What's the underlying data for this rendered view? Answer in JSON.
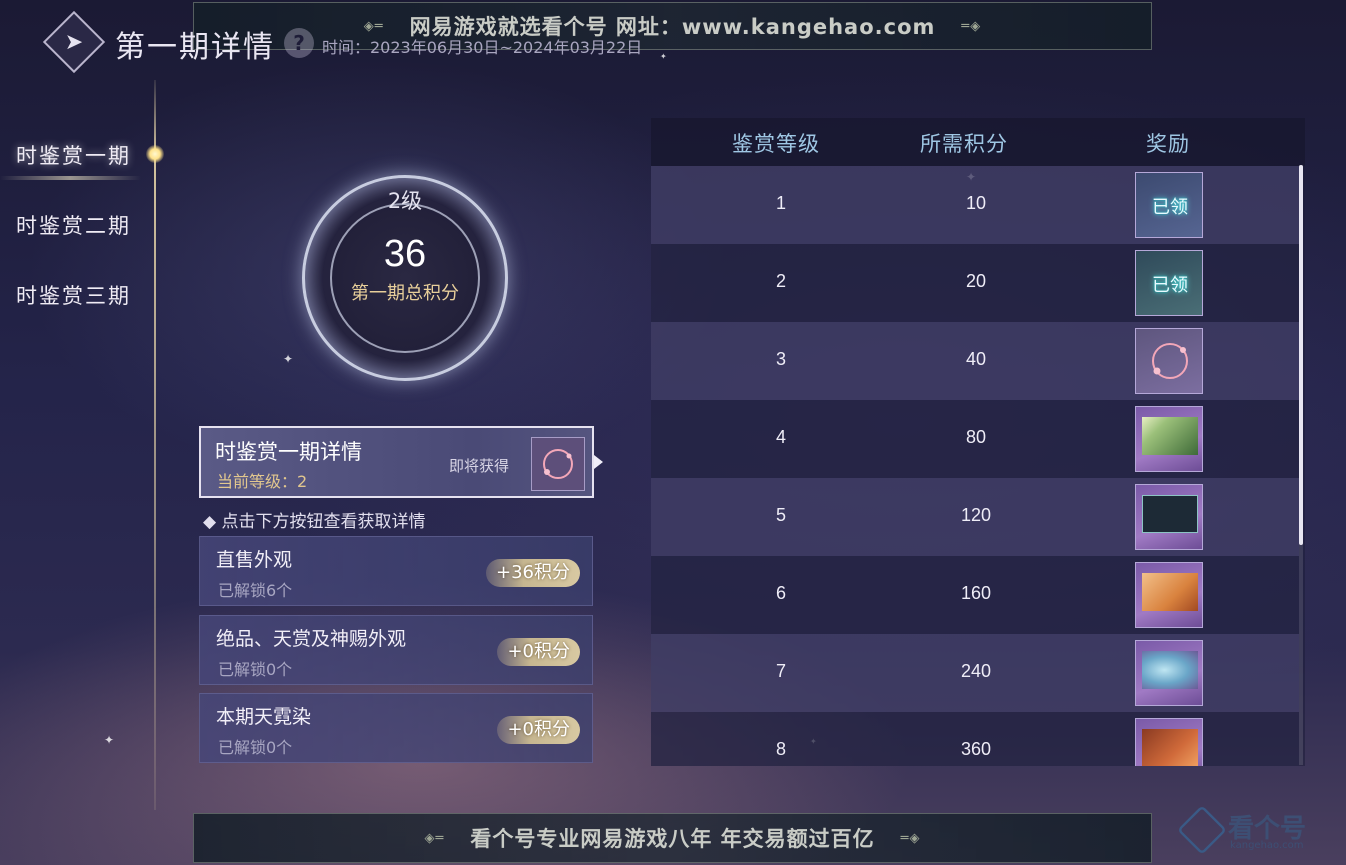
{
  "watermark": {
    "top": "网易游戏就选看个号   网址：www.kangehao.com",
    "bottom": "看个号专业网易游戏八年   年交易额过百亿"
  },
  "header": {
    "title": "第一期详情",
    "help_icon": "question-icon",
    "time_label": "时间：2023年06月30日~2024年03月22日"
  },
  "nav": {
    "items": [
      {
        "label": "时鉴赏一期",
        "active": true
      },
      {
        "label": "时鉴赏二期",
        "active": false
      },
      {
        "label": "时鉴赏三期",
        "active": false
      }
    ]
  },
  "level": {
    "level_text": "2级",
    "score": "36",
    "caption": "第一期总积分"
  },
  "detail": {
    "title": "时鉴赏一期详情",
    "current_level": "当前等级：2",
    "coming_soon": "即将获得"
  },
  "hint": "点击下方按钮查看获取详情",
  "categories": [
    {
      "name": "直售外观",
      "unlocked": "已解锁6个",
      "badge": "+36积分"
    },
    {
      "name": "绝品、天赏及神赐外观",
      "unlocked": "已解锁0个",
      "badge": "+0积分"
    },
    {
      "name": "本期天霓染",
      "unlocked": "已解锁0个",
      "badge": "+0积分"
    }
  ],
  "table": {
    "headers": {
      "level": "鉴赏等级",
      "points": "所需积分",
      "reward": "奖励"
    },
    "rows": [
      {
        "level": "1",
        "points": "10",
        "status": "已领"
      },
      {
        "level": "2",
        "points": "20",
        "status": "已领"
      },
      {
        "level": "3",
        "points": "40",
        "status": ""
      },
      {
        "level": "4",
        "points": "80",
        "status": ""
      },
      {
        "level": "5",
        "points": "120",
        "status": ""
      },
      {
        "level": "6",
        "points": "160",
        "status": ""
      },
      {
        "level": "7",
        "points": "240",
        "status": ""
      },
      {
        "level": "8",
        "points": "360",
        "status": ""
      }
    ]
  },
  "logo": {
    "text": "看个号",
    "sub": "kangehao.com"
  }
}
